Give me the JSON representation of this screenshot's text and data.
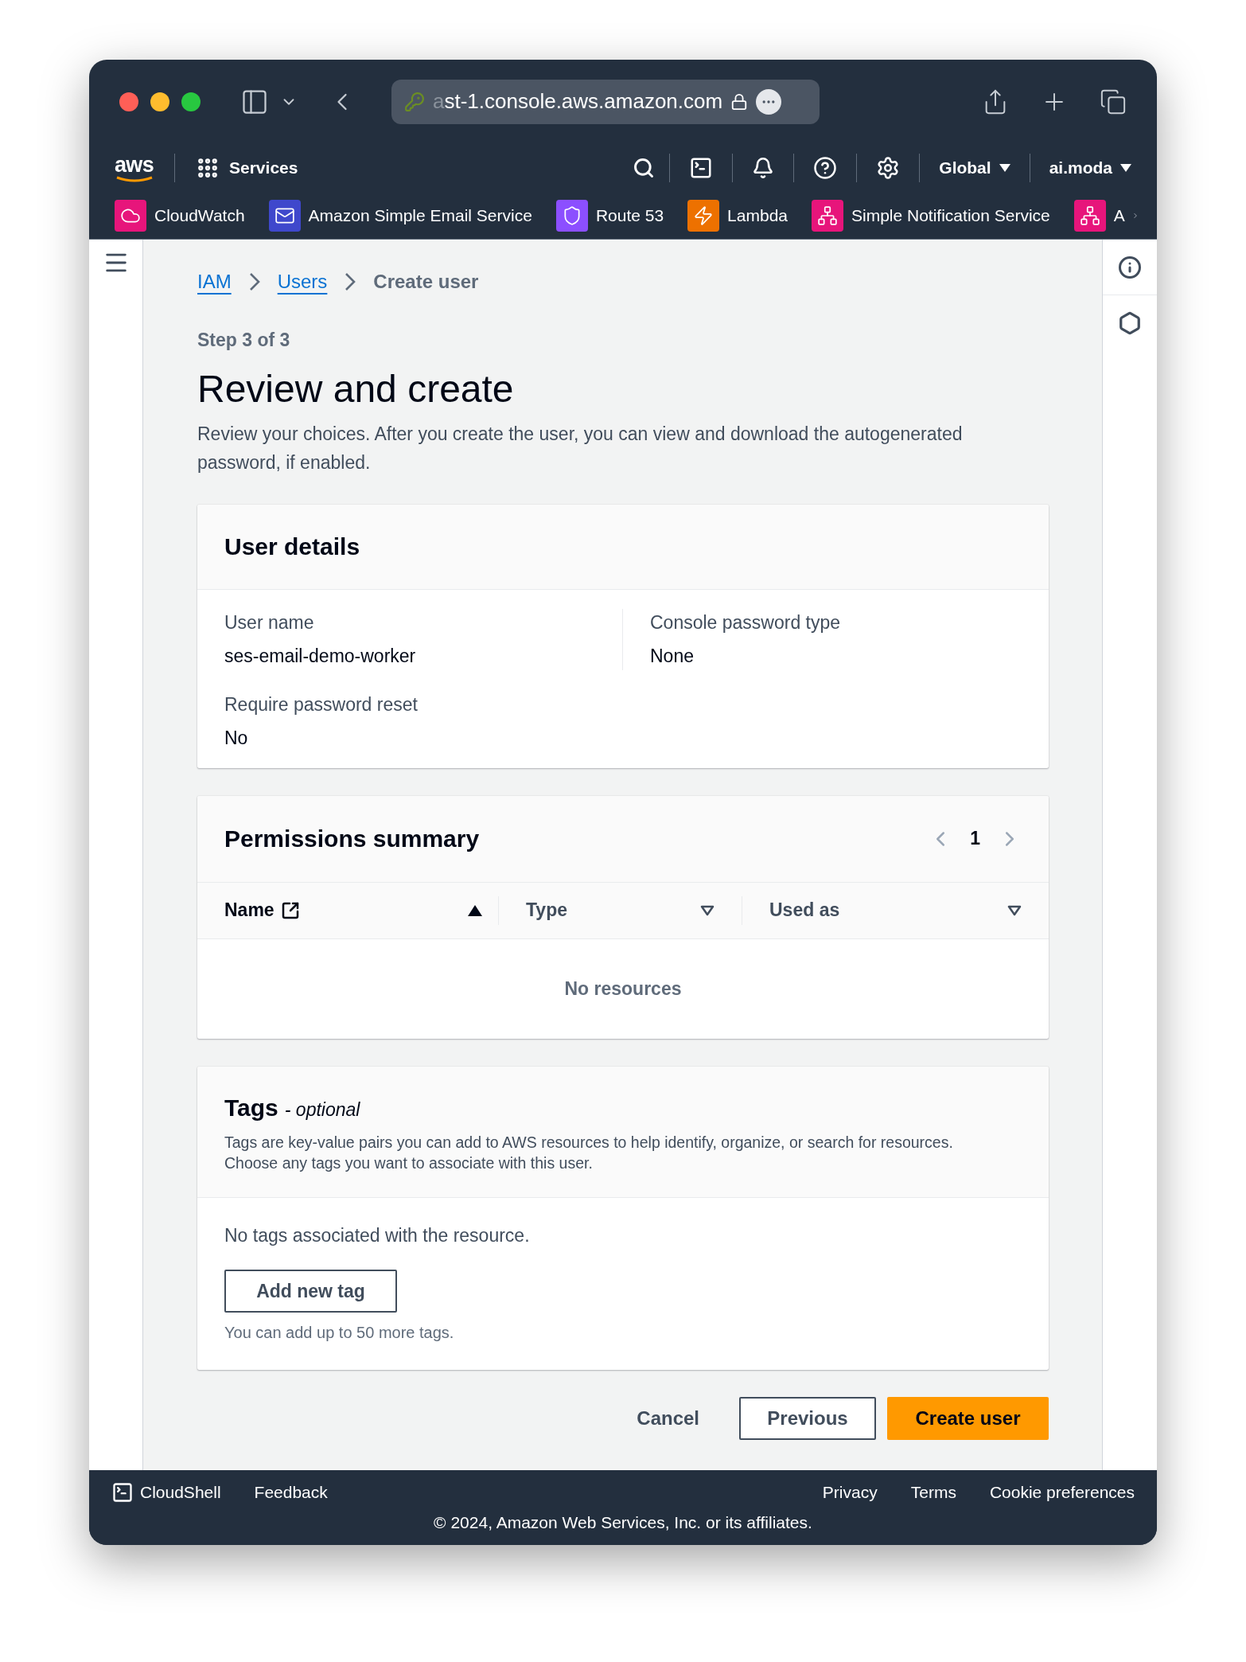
{
  "browser": {
    "address_faded": "a",
    "address": "st-1.console.aws.amazon.com"
  },
  "nav": {
    "logo": "aws",
    "services": "Services",
    "region": "Global",
    "account": "ai.moda"
  },
  "favorites": [
    {
      "label": "CloudWatch",
      "color": "#e7157b"
    },
    {
      "label": "Amazon Simple Email Service",
      "color": "#3f48cc"
    },
    {
      "label": "Route 53",
      "color": "#8c4fff"
    },
    {
      "label": "Lambda",
      "color": "#ed7100"
    },
    {
      "label": "Simple Notification Service",
      "color": "#e7157b"
    },
    {
      "label": "A",
      "color": "#e7157b"
    }
  ],
  "breadcrumbs": [
    {
      "label": "IAM",
      "kind": "link"
    },
    {
      "label": "Users",
      "kind": "link"
    },
    {
      "label": "Create user",
      "kind": "current"
    }
  ],
  "step": "Step 3 of 3",
  "title": "Review and create",
  "description": "Review your choices. After you create the user, you can view and download the autogenerated password, if enabled.",
  "user_details": {
    "title": "User details",
    "fields": [
      {
        "label": "User name",
        "value": "ses-email-demo-worker"
      },
      {
        "label": "Console password type",
        "value": "None"
      },
      {
        "label": "Require password reset",
        "value": "No"
      }
    ]
  },
  "permissions": {
    "title": "Permissions summary",
    "page": "1",
    "columns": [
      {
        "label": "Name",
        "external": true,
        "sorted": true
      },
      {
        "label": "Type",
        "external": false,
        "sorted": false
      },
      {
        "label": "Used as",
        "external": false,
        "sorted": false
      }
    ],
    "empty": "No resources"
  },
  "tags": {
    "title": "Tags",
    "optional": "- optional",
    "description": "Tags are key-value pairs you can add to AWS resources to help identify, organize, or search for resources. Choose any tags you want to associate with this user.",
    "empty": "No tags associated with the resource.",
    "add_button": "Add new tag",
    "hint": "You can add up to 50 more tags."
  },
  "actions": {
    "cancel": "Cancel",
    "previous": "Previous",
    "create": "Create user"
  },
  "footer": {
    "cloudshell": "CloudShell",
    "feedback": "Feedback",
    "links": [
      "Privacy",
      "Terms",
      "Cookie preferences"
    ],
    "copyright": "© 2024, Amazon Web Services, Inc. or its affiliates."
  }
}
